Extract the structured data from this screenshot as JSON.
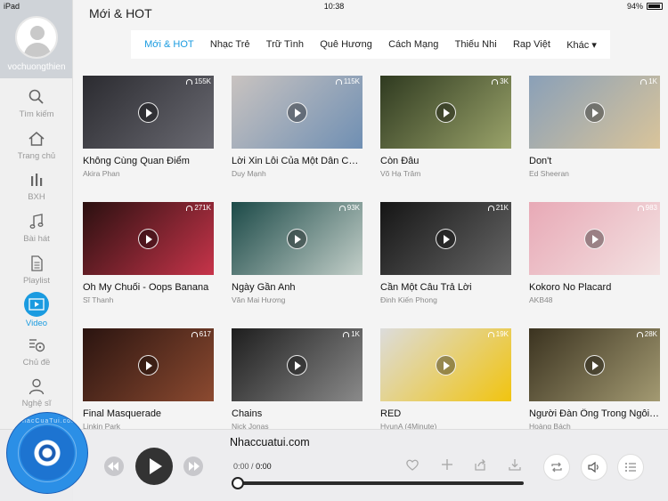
{
  "status": {
    "device": "iPad",
    "time": "10:38",
    "battery": "94%"
  },
  "profile": {
    "username": "vochuongthien"
  },
  "nav": [
    {
      "label": "Tìm kiếm",
      "icon": "search-icon"
    },
    {
      "label": "Trang chủ",
      "icon": "home-icon"
    },
    {
      "label": "BXH",
      "icon": "chart-icon"
    },
    {
      "label": "Bài hát",
      "icon": "music-note-icon"
    },
    {
      "label": "Playlist",
      "icon": "playlist-icon"
    },
    {
      "label": "Video",
      "icon": "video-icon"
    },
    {
      "label": "Chủ đề",
      "icon": "topic-icon"
    },
    {
      "label": "Nghệ sĩ",
      "icon": "artist-icon"
    }
  ],
  "header": {
    "title": "Mới & HOT"
  },
  "tabs": [
    {
      "label": "Mới & HOT"
    },
    {
      "label": "Nhạc Trẻ"
    },
    {
      "label": "Trữ Tình"
    },
    {
      "label": "Quê Hương"
    },
    {
      "label": "Cách Mạng"
    },
    {
      "label": "Thiếu Nhi"
    },
    {
      "label": "Rap Việt"
    },
    {
      "label": "Khác ▾"
    }
  ],
  "videos": [
    {
      "title": "Không Cùng Quan Điểm",
      "artist": "Akira Phan",
      "views": "155K",
      "colors": [
        "#2b2b30",
        "#6a6a72"
      ]
    },
    {
      "title": "Lời Xin Lỗi Của Một Dân Chơi",
      "artist": "Duy Mạnh",
      "views": "115K",
      "colors": [
        "#c9c3c0",
        "#6f8fb3"
      ]
    },
    {
      "title": "Còn Đâu",
      "artist": "Võ Hạ Trâm",
      "views": "3K",
      "colors": [
        "#2f3a20",
        "#9aa36a"
      ]
    },
    {
      "title": "Don't",
      "artist": "Ed Sheeran",
      "views": "1K",
      "colors": [
        "#8aa0b8",
        "#d9c49a"
      ]
    },
    {
      "title": "Oh My Chuối - Oops Banana",
      "artist": "Sĩ Thanh",
      "views": "271K",
      "colors": [
        "#2a1010",
        "#c7344a"
      ]
    },
    {
      "title": "Ngày Gần Anh",
      "artist": "Văn Mai Hương",
      "views": "93K",
      "colors": [
        "#1c4a48",
        "#c3cfc9"
      ]
    },
    {
      "title": "Cần Một Câu Trả Lời",
      "artist": "Đinh Kiến Phong",
      "views": "21K",
      "colors": [
        "#151515",
        "#666666"
      ]
    },
    {
      "title": "Kokoro No Placard",
      "artist": "AKB48",
      "views": "983",
      "colors": [
        "#e8a9b6",
        "#f3e2e2"
      ]
    },
    {
      "title": "Final Masquerade",
      "artist": "Linkin Park",
      "views": "617",
      "colors": [
        "#2a1410",
        "#8c4a30"
      ]
    },
    {
      "title": "Chains",
      "artist": "Nick Jonas",
      "views": "1K",
      "colors": [
        "#1e1e1e",
        "#8a8a8a"
      ]
    },
    {
      "title": "RED",
      "artist": "HyunA (4Minute)",
      "views": "19K",
      "colors": [
        "#dcdcdc",
        "#f1c40f"
      ]
    },
    {
      "title": "Người Đàn Ông Trong Ngôi Nhà",
      "artist": "Hoàng Bách",
      "views": "28K",
      "colors": [
        "#3b3320",
        "#a39a72"
      ]
    }
  ],
  "player": {
    "site": "Nhaccuatui.com",
    "current_time": "0:00",
    "separator": "/",
    "total_time": "0:00",
    "progress": 0,
    "disc_text": "NhacCuaTui.com"
  }
}
